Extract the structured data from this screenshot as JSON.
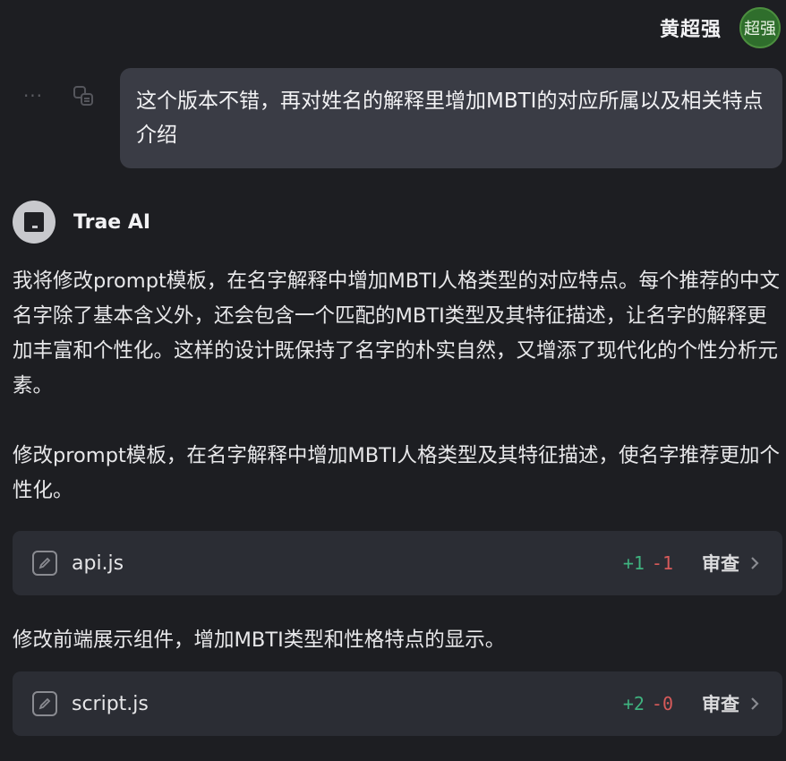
{
  "user": {
    "name": "黄超强",
    "avatar_text": "超强"
  },
  "user_message": {
    "text": "这个版本不错，再对姓名的解释里增加MBTI的对应所属以及相关特点介绍"
  },
  "assistant": {
    "name": "Trae AI",
    "paragraphs": [
      "我将修改prompt模板，在名字解释中增加MBTI人格类型的对应特点。每个推荐的中文名字除了基本含义外，还会包含一个匹配的MBTI类型及其特征描述，让名字的解释更加丰富和个性化。这样的设计既保持了名字的朴实自然，又增添了现代化的个性分析元素。",
      "修改prompt模板，在名字解释中增加MBTI人格类型及其特征描述，使名字推荐更加个性化。",
      "修改前端展示组件，增加MBTI类型和性格特点的显示。"
    ],
    "files": [
      {
        "name": "api.js",
        "added": "+1",
        "removed": "-1",
        "review_label": "审查"
      },
      {
        "name": "script.js",
        "added": "+2",
        "removed": "-0",
        "review_label": "审查"
      }
    ]
  },
  "colors": {
    "background": "#1d1e22",
    "bubble": "#3a3c45",
    "card": "#2b2d34",
    "diff_add": "#3fb27f",
    "diff_del": "#d75a5a",
    "avatar_user": "#2f6e2c"
  },
  "icons": [
    "more-icon",
    "translate-icon",
    "trae-logo-icon",
    "edit-icon",
    "chevron-right-icon"
  ]
}
